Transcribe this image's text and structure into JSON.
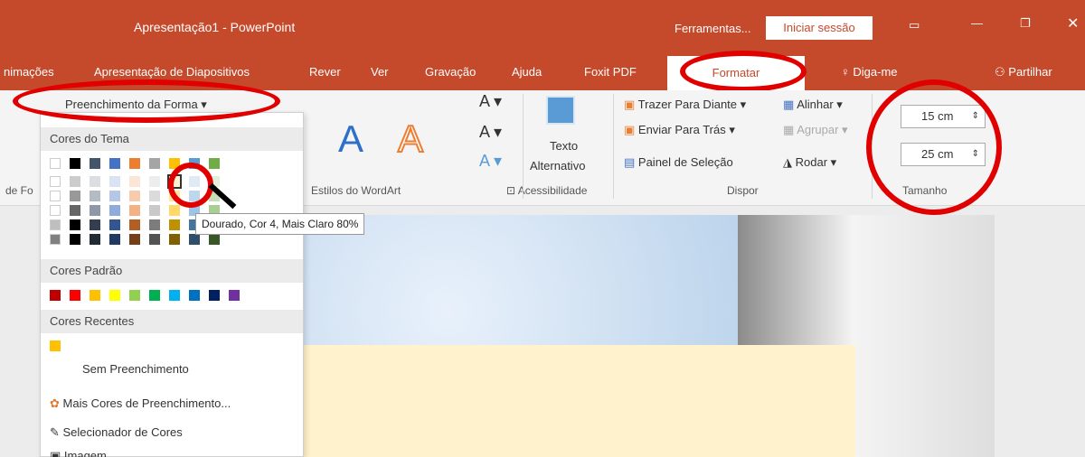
{
  "window": {
    "title": "Apresentação1  -  PowerPoint",
    "tools_label": "Ferramentas...",
    "signin_label": "Iniciar sessão"
  },
  "tabs": [
    {
      "label": "nimações"
    },
    {
      "label": "Apresentação de Diapositivos"
    },
    {
      "label": "Rever"
    },
    {
      "label": "Ver"
    },
    {
      "label": "Gravação"
    },
    {
      "label": "Ajuda"
    },
    {
      "label": "Foxit PDF"
    },
    {
      "label": "Formatar"
    },
    {
      "label": "Diga-me"
    },
    {
      "label": "Partilhar"
    }
  ],
  "ribbon": {
    "shape_fill_label": "Preenchimento da Forma",
    "group_labels": {
      "font": "de Fo",
      "wordart": "Estilos do WordArt",
      "accessibility": "Acessibilidade",
      "arrange": "Dispor",
      "size": "Tamanho"
    },
    "alt_text": {
      "line1": "Texto",
      "line2": "Alternativo"
    },
    "arrange": {
      "bring_forward": "Trazer Para Diante",
      "send_backward": "Enviar Para Trás",
      "selection_pane": "Painel de Seleção",
      "align": "Alinhar",
      "group": "Agrupar",
      "rotate": "Rodar"
    },
    "size": {
      "height": "15 cm",
      "width": "25 cm"
    },
    "wordart_letters": [
      "A",
      "A"
    ]
  },
  "dropdown": {
    "theme_colors_label": "Cores do Tema",
    "standard_colors_label": "Cores Padrão",
    "recent_colors_label": "Cores Recentes",
    "no_fill": "Sem Preenchimento",
    "more_colors": "Mais Cores de Preenchimento...",
    "eyedropper": "Selecionador de Cores",
    "picture": "Imagem...",
    "tooltip": "Dourado, Cor 4, Mais Claro 80%",
    "theme_colors": [
      "#ffffff",
      "#000000",
      "#44546a",
      "#4472c4",
      "#ed7d31",
      "#a5a5a5",
      "#ffc000",
      "#5b9bd5",
      "#70ad47"
    ],
    "standard_colors": [
      "#c00000",
      "#ff0000",
      "#ffc000",
      "#ffff00",
      "#92d050",
      "#00b050",
      "#00b0f0",
      "#0070c0",
      "#002060",
      "#7030a0"
    ],
    "recent_colors": [
      "#ffc000"
    ]
  },
  "icons": [
    "eyedropper-icon",
    "color-wheel-icon",
    "picture-icon",
    "minimize-icon",
    "maximize-icon",
    "close-icon",
    "lightbulb-icon",
    "person-icon"
  ]
}
